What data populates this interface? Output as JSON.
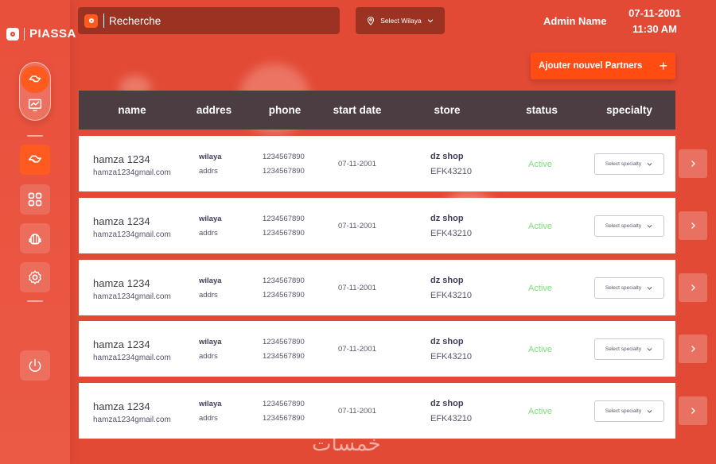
{
  "brand": {
    "name": "PIASSA"
  },
  "search": {
    "placeholder": "Recherche"
  },
  "wilaya": {
    "label": "Select Wilaya"
  },
  "user": {
    "name": "Admin Name"
  },
  "clock": {
    "date": "07-11-2001",
    "time": "11:30 AM"
  },
  "actions": {
    "add_partner": "Ajouter nouvel Partners",
    "add_icon": "+"
  },
  "table": {
    "headers": [
      "name",
      "addres",
      "phone",
      "start date",
      "store",
      "status",
      "specialty"
    ],
    "rows": [
      {
        "name": "hamza 1234",
        "email": "hamza1234gmail.com",
        "wilaya": "wilaya",
        "addr": "addrs",
        "phone1": "1234567890",
        "phone2": "1234567890",
        "date": "07-11-2001",
        "store": "dz shop",
        "store_code": "EFK43210",
        "status": "Active",
        "specialty": "Select specialty"
      },
      {
        "name": "hamza 1234",
        "email": "hamza1234gmail.com",
        "wilaya": "wilaya",
        "addr": "addrs",
        "phone1": "1234567890",
        "phone2": "1234567890",
        "date": "07-11-2001",
        "store": "dz shop",
        "store_code": "EFK43210",
        "status": "Active",
        "specialty": "Select specialty"
      },
      {
        "name": "hamza 1234",
        "email": "hamza1234gmail.com",
        "wilaya": "wilaya",
        "addr": "addrs",
        "phone1": "1234567890",
        "phone2": "1234567890",
        "date": "07-11-2001",
        "store": "dz shop",
        "store_code": "EFK43210",
        "status": "Active",
        "specialty": "Select specialty"
      },
      {
        "name": "hamza 1234",
        "email": "hamza1234gmail.com",
        "wilaya": "wilaya",
        "addr": "addrs",
        "phone1": "1234567890",
        "phone2": "1234567890",
        "date": "07-11-2001",
        "store": "dz shop",
        "store_code": "EFK43210",
        "status": "Active",
        "specialty": "Select specialty"
      },
      {
        "name": "hamza 1234",
        "email": "hamza1234gmail.com",
        "wilaya": "wilaya",
        "addr": "addrs",
        "phone1": "1234567890",
        "phone2": "1234567890",
        "date": "07-11-2001",
        "store": "dz shop",
        "store_code": "EFK43210",
        "status": "Active",
        "specialty": "Select specialty"
      }
    ]
  },
  "watermark": "خمسات",
  "colors": {
    "background": "#e24a36",
    "accent": "#ff4c13",
    "header": "#4b3d41",
    "active": "#7be07b"
  },
  "icons": {
    "sidebar": [
      "partners-icon",
      "analytics-icon",
      "partners-icon",
      "dashboard-grid-icon",
      "support-agent-icon",
      "settings-icon",
      "logout-icon"
    ]
  }
}
